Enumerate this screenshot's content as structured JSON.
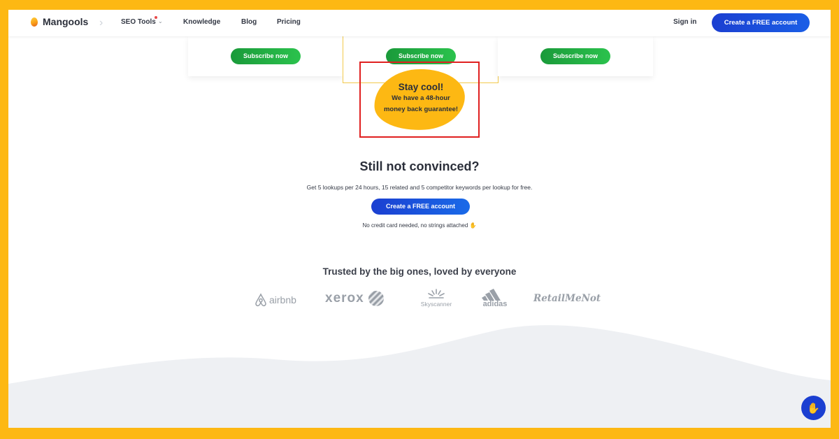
{
  "nav": {
    "logo_text": "Mangools",
    "items": [
      {
        "label": "SEO Tools"
      },
      {
        "label": "Knowledge"
      },
      {
        "label": "Blog"
      },
      {
        "label": "Pricing"
      }
    ],
    "sign_in": "Sign in",
    "create_account": "Create a FREE account"
  },
  "pricing_cards": [
    {
      "button_label": "Subscribe now"
    },
    {
      "button_label": "Subscribe now"
    },
    {
      "button_label": "Subscribe now"
    }
  ],
  "guarantee": {
    "title": "Stay cool!",
    "line1": "We have a 48-hour",
    "line2": "money back guarantee!"
  },
  "cta": {
    "title": "Still not convinced?",
    "description": "Get 5 lookups per 24 hours, 15 related and 5 competitor keywords per lookup for free.",
    "button_label": "Create a FREE account",
    "note": "No credit card needed, no strings attached"
  },
  "trusted": {
    "title": "Trusted by the big ones, loved by everyone",
    "logos": [
      "airbnb",
      "xerox",
      "Skyscanner",
      "adidas",
      "RetailMeNot"
    ]
  },
  "colors": {
    "frame": "#fdb813",
    "primary": "#1b3fd1",
    "subscribe": "#22b044",
    "highlight_border": "#e02020"
  }
}
